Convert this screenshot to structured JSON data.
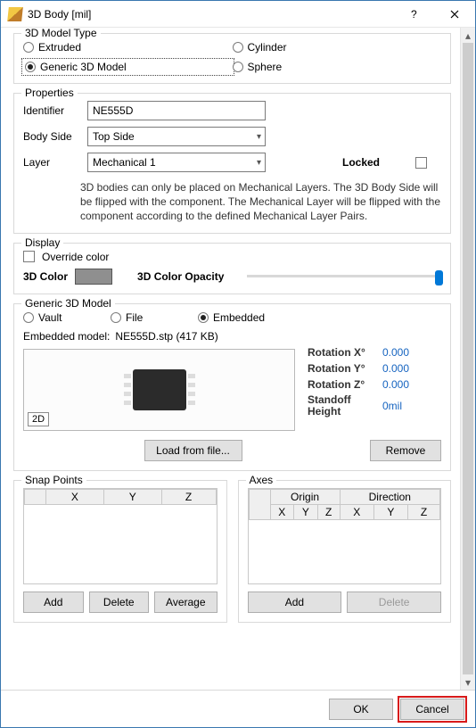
{
  "title": "3D Body [mil]",
  "model_type": {
    "legend": "3D Model Type",
    "options": {
      "extruded": "Extruded",
      "cylinder": "Cylinder",
      "generic": "Generic 3D Model",
      "sphere": "Sphere"
    },
    "selected": "generic"
  },
  "properties": {
    "legend": "Properties",
    "identifier_label": "Identifier",
    "identifier": "NE555D",
    "body_side_label": "Body Side",
    "body_side": "Top Side",
    "layer_label": "Layer",
    "layer": "Mechanical 1",
    "locked_label": "Locked",
    "locked": false,
    "note": "3D bodies can only be placed on Mechanical Layers. The 3D Body Side will be flipped with the component. The Mechanical Layer will be flipped with the component according to the defined Mechanical Layer Pairs."
  },
  "display": {
    "legend": "Display",
    "override_label": "Override color",
    "override": false,
    "color_label": "3D Color",
    "color": "#8f8f8f",
    "opacity_label": "3D Color Opacity",
    "opacity": 100
  },
  "generic": {
    "legend": "Generic 3D Model",
    "source": {
      "vault": "Vault",
      "file": "File",
      "embedded": "Embedded"
    },
    "source_selected": "embedded",
    "embedded_label": "Embedded model:",
    "embedded_name": "NE555D.stp (417 KB)",
    "preview_badge": "2D",
    "rotation_x_label": "Rotation X°",
    "rotation_x": "0.000",
    "rotation_y_label": "Rotation Y°",
    "rotation_y": "0.000",
    "rotation_z_label": "Rotation Z°",
    "rotation_z": "0.000",
    "standoff_label": "Standoff Height",
    "standoff": "0mil",
    "load_btn": "Load from file...",
    "remove_btn": "Remove"
  },
  "snap": {
    "legend": "Snap Points",
    "cols": {
      "x": "X",
      "y": "Y",
      "z": "Z"
    },
    "add_btn": "Add",
    "delete_btn": "Delete",
    "average_btn": "Average"
  },
  "axes": {
    "legend": "Axes",
    "group_origin": "Origin",
    "group_direction": "Direction",
    "cols": {
      "x": "X",
      "y": "Y",
      "z": "Z"
    },
    "add_btn": "Add",
    "delete_btn": "Delete"
  },
  "footer": {
    "ok": "OK",
    "cancel": "Cancel"
  }
}
